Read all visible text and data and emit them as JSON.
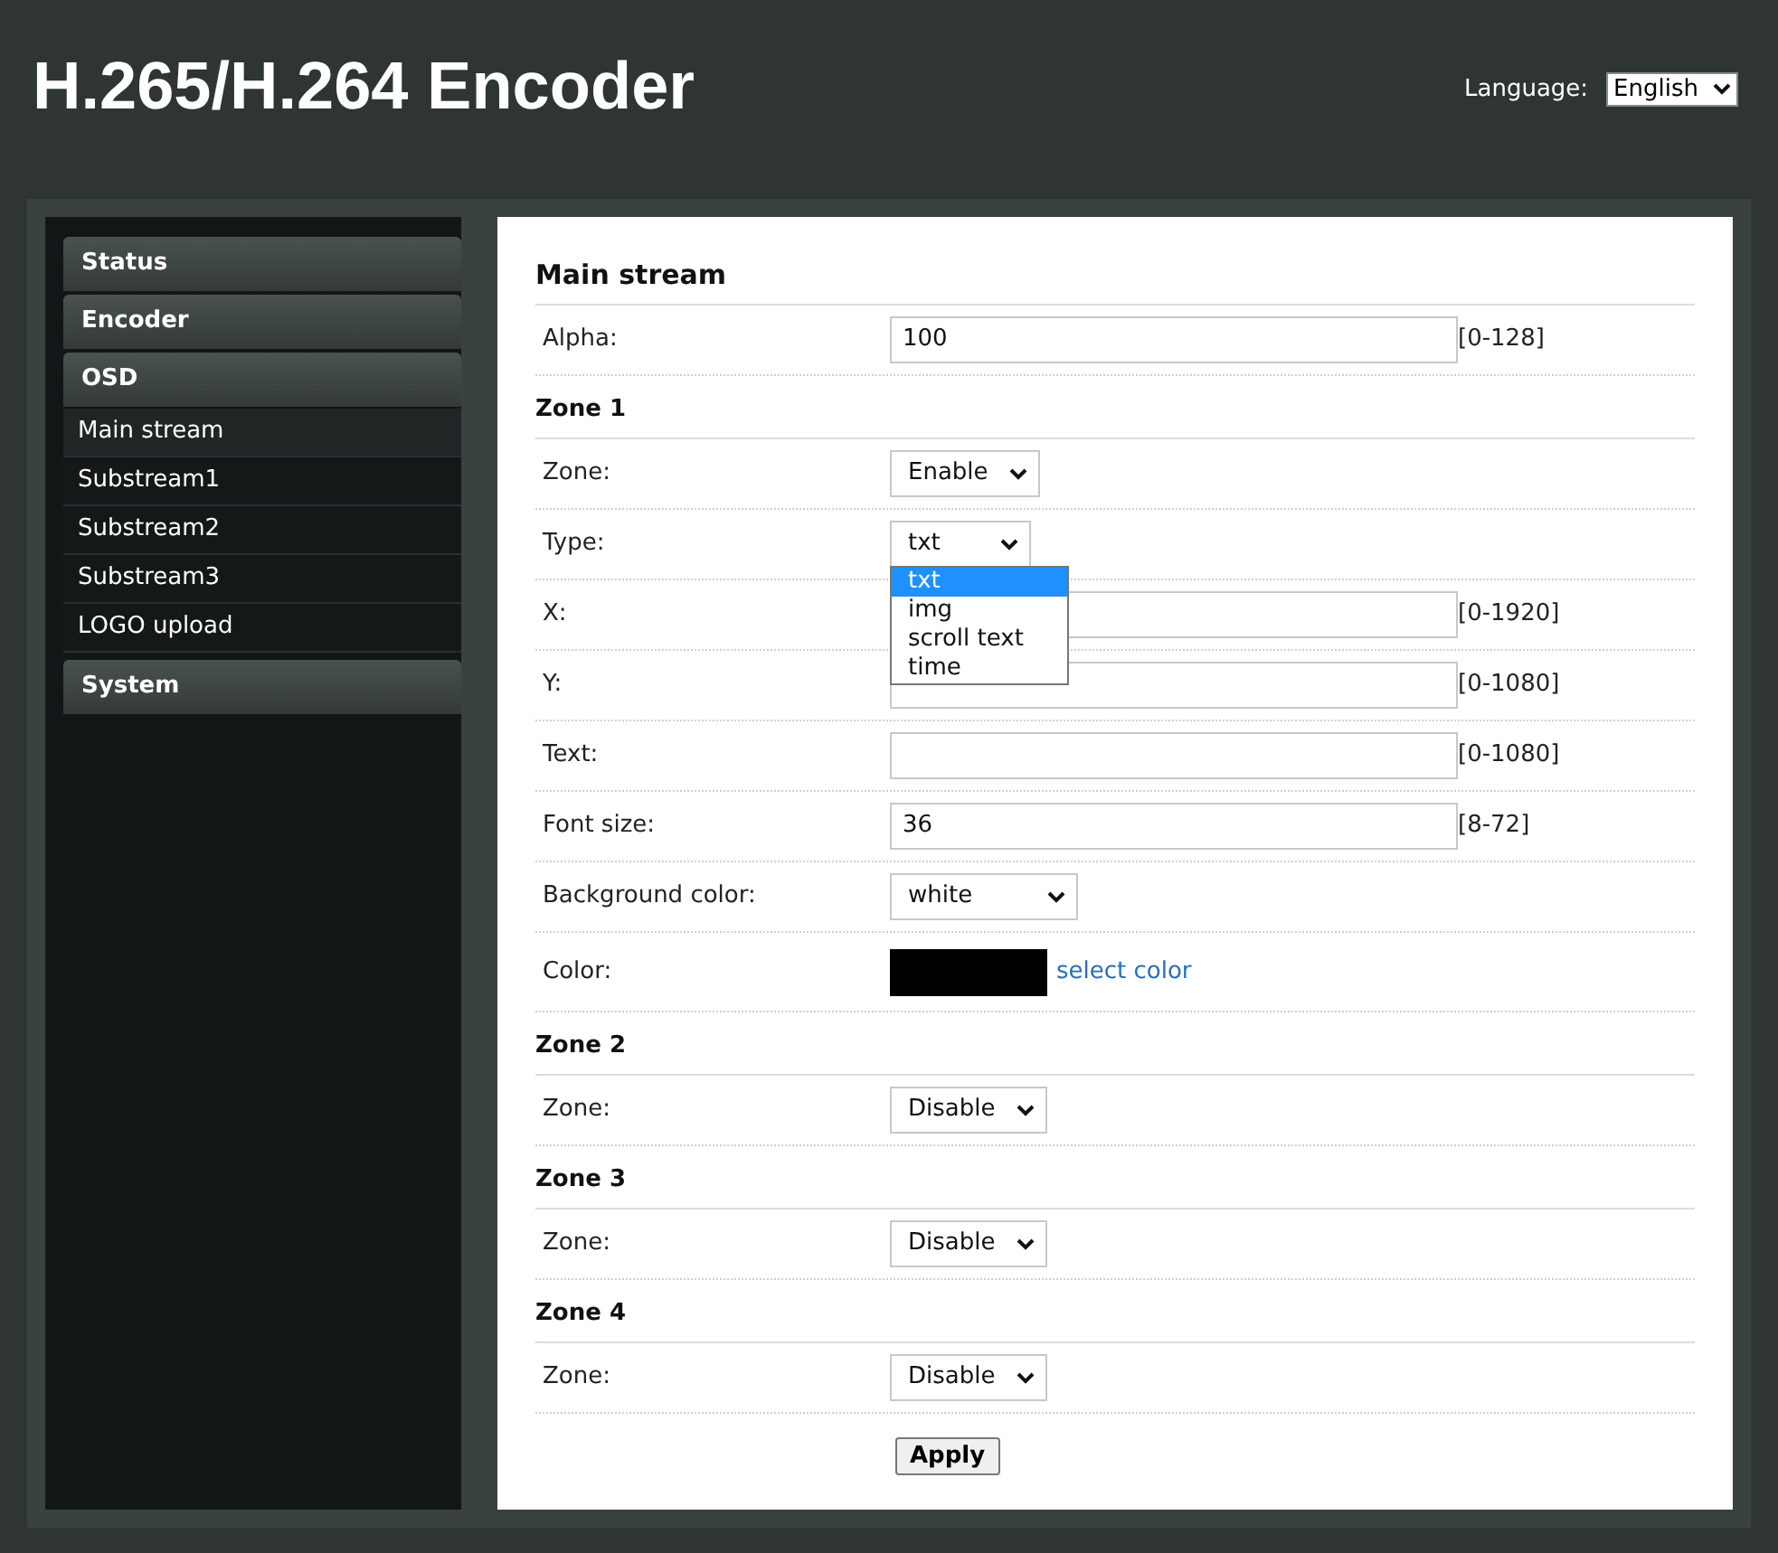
{
  "header": {
    "title": "H.265/H.264 Encoder",
    "language_label": "Language:",
    "language": "English"
  },
  "sidebar": [
    {
      "label": "Status",
      "kind": "section",
      "selected": false
    },
    {
      "label": "Encoder",
      "kind": "section",
      "selected": false
    },
    {
      "label": "OSD",
      "kind": "section",
      "selected": false
    },
    {
      "label": "Main stream",
      "kind": "item",
      "selected": true
    },
    {
      "label": "Substream1",
      "kind": "item",
      "selected": false
    },
    {
      "label": "Substream2",
      "kind": "item",
      "selected": false
    },
    {
      "label": "Substream3",
      "kind": "item",
      "selected": false
    },
    {
      "label": "LOGO upload",
      "kind": "item",
      "selected": false
    },
    {
      "label": "System",
      "kind": "section",
      "selected": false
    }
  ],
  "sections": [
    {
      "title": "Main stream",
      "rows": [
        {
          "kind": "text",
          "label": "Alpha:",
          "value": "100",
          "range": "[0-128]"
        }
      ]
    },
    {
      "title": "Zone 1",
      "rows": [
        {
          "kind": "select",
          "label": "Zone:",
          "value": "Enable"
        },
        {
          "kind": "select",
          "label": "Type:",
          "value": "txt",
          "expanded": true,
          "options": [
            {
              "label": "txt",
              "selected": true
            },
            {
              "label": "img",
              "selected": false
            },
            {
              "label": "scroll text",
              "selected": false
            },
            {
              "label": "time",
              "selected": false
            }
          ]
        },
        {
          "kind": "text",
          "label": "X:",
          "range": "[0-1920]"
        },
        {
          "kind": "text",
          "label": "Y:",
          "range": "[0-1080]"
        },
        {
          "kind": "text",
          "label": "Text:",
          "range": "[0-1080]"
        },
        {
          "kind": "text",
          "label": "Font size:",
          "value": "36",
          "range": "[8-72]"
        },
        {
          "kind": "select",
          "label": "Background color:",
          "value": "white"
        },
        {
          "kind": "color",
          "label": "Color:",
          "color": "#000000",
          "link": "select color"
        }
      ]
    },
    {
      "title": "Zone 2",
      "rows": [
        {
          "kind": "select",
          "label": "Zone:",
          "value": "Disable"
        }
      ]
    },
    {
      "title": "Zone 3",
      "rows": [
        {
          "kind": "select",
          "label": "Zone:",
          "value": "Disable"
        }
      ]
    },
    {
      "title": "Zone 4",
      "rows": [
        {
          "kind": "select",
          "label": "Zone:",
          "value": "Disable"
        }
      ]
    }
  ],
  "apply": "Apply"
}
